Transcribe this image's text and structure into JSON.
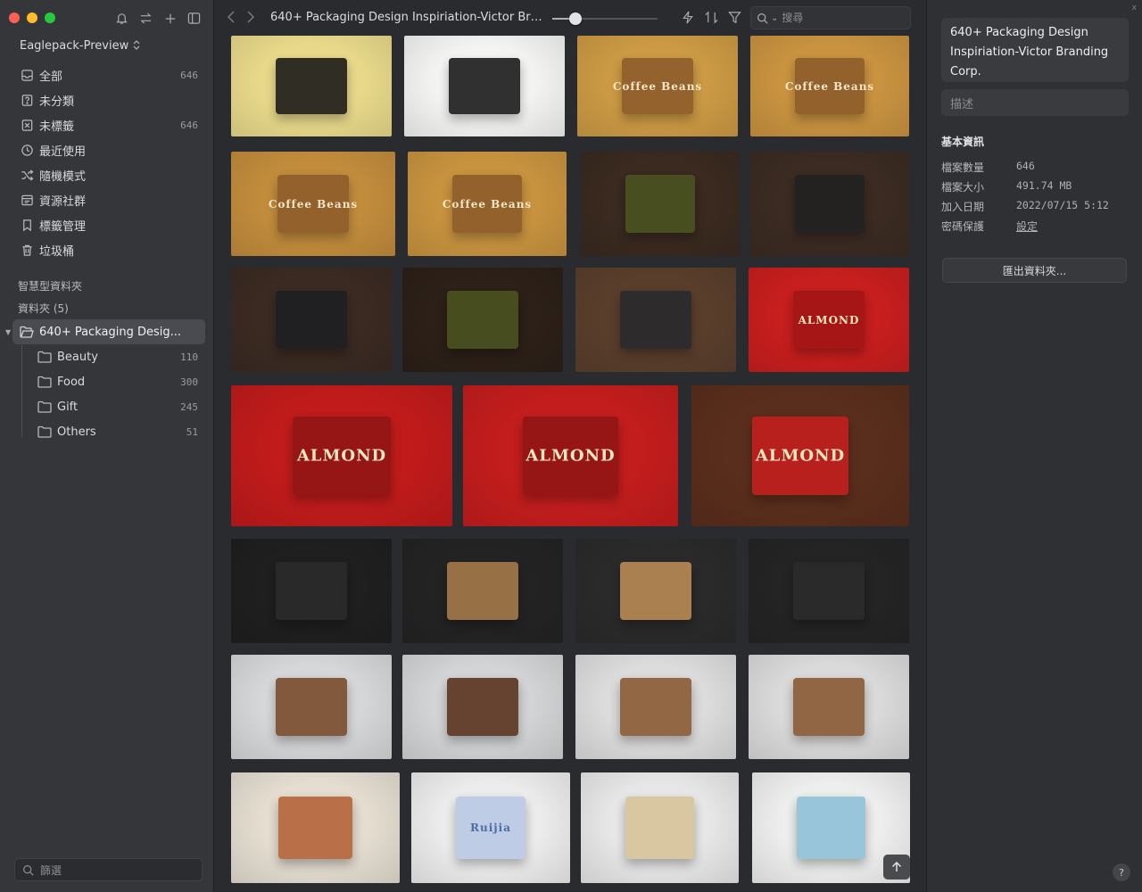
{
  "window": {
    "colors": {
      "close": "#fe5f57",
      "minimize": "#febc2e",
      "zoom": "#28c840"
    }
  },
  "sidebar": {
    "library_name": "Eaglepack-Preview",
    "library_chevron": "⌃⌄",
    "nav": [
      {
        "label": "全部",
        "count": "646",
        "icon": "inbox-icon"
      },
      {
        "label": "未分類",
        "count": "",
        "icon": "question-box-icon"
      },
      {
        "label": "未標籤",
        "count": "646",
        "icon": "tag-off-icon"
      },
      {
        "label": "最近使用",
        "count": "",
        "icon": "clock-icon"
      },
      {
        "label": "隨機模式",
        "count": "",
        "icon": "shuffle-icon"
      },
      {
        "label": "資源社群",
        "count": "",
        "icon": "community-icon"
      },
      {
        "label": "標籤管理",
        "count": "",
        "icon": "bookmark-icon"
      },
      {
        "label": "垃圾桶",
        "count": "",
        "icon": "trash-icon"
      }
    ],
    "smart_folders_label": "智慧型資料夾",
    "folders_label": "資料夾 (5)",
    "root_folder": "640+ Packaging Desig...",
    "subfolders": [
      {
        "label": "Beauty",
        "count": "110"
      },
      {
        "label": "Food",
        "count": "300"
      },
      {
        "label": "Gift",
        "count": "245"
      },
      {
        "label": "Others",
        "count": "51"
      }
    ],
    "filter_placeholder": "篩選"
  },
  "toolbar": {
    "title": "640+ Packaging Design Inspiriation-Victor Brand...",
    "zoom": 0.22,
    "search_placeholder": "搜尋",
    "search_scope": "⌄"
  },
  "grid": {
    "thumbs": [
      {
        "row": 0,
        "bg": "#e8d98a",
        "fg": "#222",
        "label": "",
        "accent": "#1c1a1a"
      },
      {
        "row": 0,
        "bg": "#f3f3f1",
        "fg": "#222",
        "label": "",
        "accent": "#1c1b1c"
      },
      {
        "row": 0,
        "bg": "#cc9a44",
        "fg": "#f4e6c8",
        "label": "Coffee Beans",
        "accent": "#8a5a2a"
      },
      {
        "row": 0,
        "bg": "#c99340",
        "fg": "#f4e6c8",
        "label": "Coffee Beans",
        "accent": "#8a5a2a"
      },
      {
        "row": 1,
        "bg": "#c28c3c",
        "fg": "#f4e6c8",
        "label": "Coffee Beans",
        "accent": "#8a5a2a"
      },
      {
        "row": 1,
        "bg": "#c8933f",
        "fg": "#f4e6c8",
        "label": "Coffee Beans",
        "accent": "#8a5a2a"
      },
      {
        "row": 1,
        "bg": "#3a2a20",
        "fg": "#c9d78a",
        "label": "",
        "accent": "#4b5320"
      },
      {
        "row": 1,
        "bg": "#3b2b22",
        "fg": "#e0e0e0",
        "label": "",
        "accent": "#222"
      },
      {
        "row": 2,
        "bg": "#3a2a22",
        "fg": "#e0e0e0",
        "label": "",
        "accent": "#1f1f22"
      },
      {
        "row": 2,
        "bg": "#2c2018",
        "fg": "#e0e0e0",
        "label": "",
        "accent": "#4b5320"
      },
      {
        "row": 2,
        "bg": "#5a3e2c",
        "fg": "#e0e0e0",
        "label": "",
        "accent": "#2a2a2e"
      },
      {
        "row": 2,
        "bg": "#c81e1e",
        "fg": "#f6e7c0",
        "label": "ALMOND",
        "accent": "#a01616"
      },
      {
        "row": 3,
        "bg": "#c11b1b",
        "fg": "#f6e7c0",
        "label": "ALMOND",
        "accent": "#8f1414"
      },
      {
        "row": 3,
        "bg": "#c41d1d",
        "fg": "#f6e7c0",
        "label": "ALMOND",
        "accent": "#8f1414"
      },
      {
        "row": 3,
        "bg": "#5a2e1c",
        "fg": "#f6e7c0",
        "label": "ALMOND",
        "accent": "#c81e1e"
      },
      {
        "row": 4,
        "bg": "#1f1f20",
        "fg": "#c99340",
        "label": "",
        "accent": "#2b2b2c"
      },
      {
        "row": 4,
        "bg": "#232324",
        "fg": "#c99340",
        "label": "",
        "accent": "#a57a4a"
      },
      {
        "row": 4,
        "bg": "#2a2a2b",
        "fg": "#c99340",
        "label": "",
        "accent": "#b88a55"
      },
      {
        "row": 4,
        "bg": "#242425",
        "fg": "#c99340",
        "label": "",
        "accent": "#2b2b2c"
      },
      {
        "row": 5,
        "bg": "#d6d7d8",
        "fg": "#333",
        "label": "",
        "accent": "#7a4c2e"
      },
      {
        "row": 5,
        "bg": "#d3d4d5",
        "fg": "#333",
        "label": "",
        "accent": "#5a3220"
      },
      {
        "row": 5,
        "bg": "#dcdcdc",
        "fg": "#333",
        "label": "",
        "accent": "#8a5a34"
      },
      {
        "row": 5,
        "bg": "#dadada",
        "fg": "#333",
        "label": "",
        "accent": "#8a5a34"
      },
      {
        "row": 6,
        "bg": "#e4ddd0",
        "fg": "#333",
        "label": "",
        "accent": "#b5653a"
      },
      {
        "row": 6,
        "bg": "#ececec",
        "fg": "#4b6ea3",
        "label": "Ruijia",
        "accent": "#b8c7e6"
      },
      {
        "row": 6,
        "bg": "#e7e7e7",
        "fg": "#333",
        "label": "",
        "accent": "#d7c49a"
      },
      {
        "row": 6,
        "bg": "#eeeeee",
        "fg": "#333",
        "label": "",
        "accent": "#8fc1d8"
      }
    ]
  },
  "inspector": {
    "name": "640+ Packaging Design Inspiriation-Victor Branding Corp.",
    "desc_placeholder": "描述",
    "info_title": "基本資訊",
    "rows": [
      {
        "key": "檔案數量",
        "value": "646"
      },
      {
        "key": "檔案大小",
        "value": "491.74 MB"
      },
      {
        "key": "加入日期",
        "value": "2022/07/15 5:12"
      },
      {
        "key": "密碼保護",
        "value": "設定"
      }
    ],
    "export_label": "匯出資料夾...",
    "help_label": "?"
  }
}
